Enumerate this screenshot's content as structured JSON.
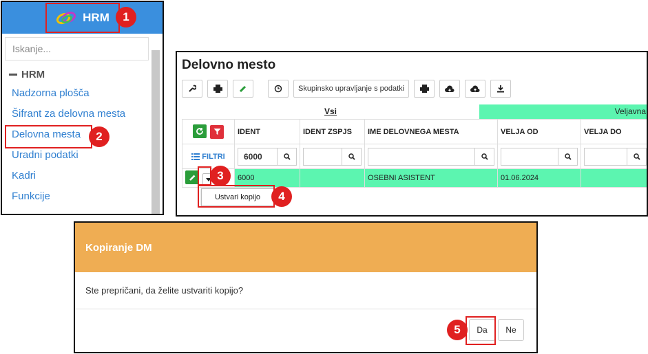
{
  "sidebar": {
    "app_name": "HRM",
    "search_placeholder": "Iskanje...",
    "section_title": "HRM",
    "items": [
      {
        "label": "Nadzorna plošča"
      },
      {
        "label": "Šifrant za delovna mesta"
      },
      {
        "label": "Delovna mesta"
      },
      {
        "label": "Uradni podatki"
      },
      {
        "label": "Kadri"
      },
      {
        "label": "Funkcije"
      }
    ],
    "accent_color": "#3a8fde"
  },
  "workplace": {
    "title": "Delovno mesto",
    "toolbar": {
      "group_manage_label": "Skupinsko upravljanje s podatki"
    },
    "tabs": {
      "all_label": "Vsi",
      "valid_label": "Veljavna"
    },
    "filters_label": "FILTRI",
    "columns": [
      "IDENT",
      "IDENT ZSPJS",
      "IME DELOVNEGA MESTA",
      "VELJA OD",
      "VELJA DO"
    ],
    "filter_values": {
      "ident": "6000"
    },
    "rows": [
      {
        "ident": "6000",
        "ident_zspjs": "",
        "name": "OSEBNI ASISTENT",
        "valid_from": "01.06.2024",
        "valid_to": ""
      }
    ],
    "dropdown_item": "Ustvari kopijo",
    "row_color": "#5cf5b0"
  },
  "dialog": {
    "title": "Kopiranje DM",
    "message": "Ste prepričani, da želite ustvariti kopijo?",
    "yes_label": "Da",
    "no_label": "Ne",
    "header_color": "#efad53"
  },
  "callouts": [
    "1",
    "2",
    "3",
    "4",
    "5"
  ]
}
